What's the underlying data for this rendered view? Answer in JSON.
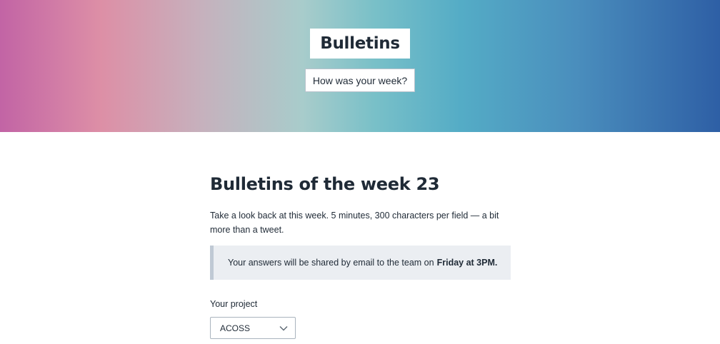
{
  "header": {
    "title": "Bulletins",
    "subtitle_button": "How was your week?"
  },
  "main": {
    "title": "Bulletins of the week 23",
    "intro": "Take a look back at this week. 5 minutes, 300 characters per field — a bit more than a tweet.",
    "notice": {
      "text": "Your answers will be shared by email to the team on",
      "emphasis": "Friday at 3PM."
    },
    "project_field": {
      "label": "Your project",
      "selected": "ACOSS",
      "icon": "chevron-down-icon"
    }
  },
  "colors": {
    "text": "#1f2a36",
    "notice_bg": "#ebeef2",
    "notice_border": "#bfc9d4",
    "gradient_start": "#c264a5",
    "gradient_end": "#2e5fa5"
  }
}
